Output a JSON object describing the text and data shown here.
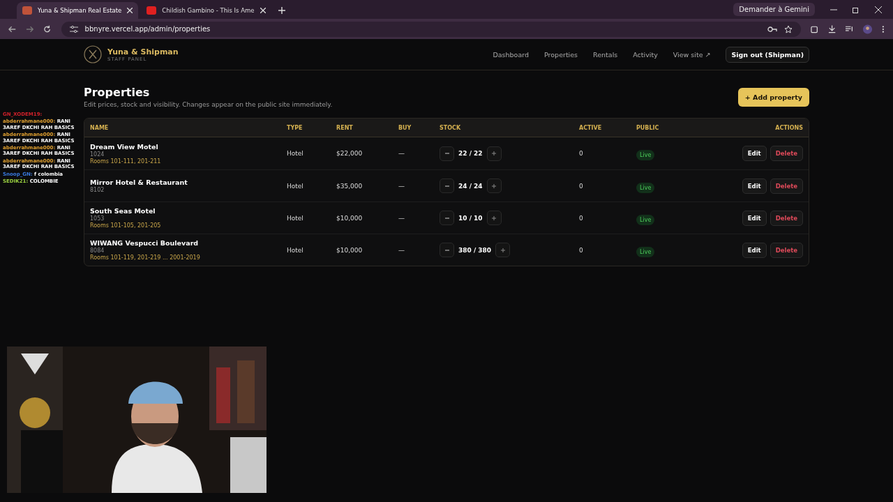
{
  "browser": {
    "tabs": [
      {
        "title": "Yuna & Shipman Real Estate",
        "selected": true
      },
      {
        "title": "Childish Gambino - This Is Ame",
        "selected": false
      }
    ],
    "gemini_button": "Demander à Gemini",
    "url": "bbnyre.vercel.app/admin/properties"
  },
  "header": {
    "brand": "Yuna & Shipman",
    "subtitle": "STAFF PANEL",
    "nav": [
      "Dashboard",
      "Properties",
      "Rentals",
      "Activity",
      "View site ↗"
    ],
    "sign_out": "Sign out (Shipman)"
  },
  "page": {
    "title": "Properties",
    "description": "Edit prices, stock and visibility. Changes appear on the public site immediately.",
    "add_button": "+ Add property"
  },
  "table": {
    "columns": [
      "NAME",
      "TYPE",
      "RENT",
      "BUY",
      "STOCK",
      "ACTIVE",
      "PUBLIC",
      "ACTIONS"
    ],
    "rows": [
      {
        "name": "Dream View Motel",
        "code": "1024",
        "rooms": "Rooms 101-111, 201-211",
        "type": "Hotel",
        "rent": "$22,000",
        "buy": "—",
        "stock": "22 / 22",
        "active": "0",
        "public": "Live",
        "edit": "Edit",
        "delete": "Delete"
      },
      {
        "name": "Mirror Hotel & Restaurant",
        "code": "8102",
        "type": "Hotel",
        "rent": "$35,000",
        "buy": "—",
        "stock": "24 / 24",
        "active": "0",
        "public": "Live",
        "edit": "Edit",
        "delete": "Delete"
      },
      {
        "name": "South Seas Motel",
        "code": "1053",
        "rooms": "Rooms 101-105, 201-205",
        "type": "Hotel",
        "rent": "$10,000",
        "buy": "—",
        "stock": "10 / 10",
        "active": "0",
        "public": "Live",
        "edit": "Edit",
        "delete": "Delete"
      },
      {
        "name": "WIWANG Vespucci Boulevard",
        "code": "8084",
        "rooms": "Rooms 101-119, 201-219 ... 2001-2019",
        "type": "Hotel",
        "rent": "$10,000",
        "buy": "—",
        "stock": "380 / 380",
        "active": "0",
        "public": "Live",
        "edit": "Edit",
        "delete": "Delete"
      }
    ]
  },
  "stream_chat": [
    {
      "user": "GN_XODEM19:",
      "color": "#d0202a"
    },
    {
      "user": "abderrahmane000:",
      "message": "RANI 3AREF DKCHI RAH BASICS",
      "color": "#e0a030"
    },
    {
      "user": "abderrahmane000:",
      "message": "RANI 3AREF DKCHI RAH BASICS",
      "color": "#e0a030"
    },
    {
      "user": "abderrahmane000:",
      "message": "RANI 3AREF DKCHI RAH BASICS",
      "color": "#e0a030"
    },
    {
      "user": "abderrahmane000:",
      "message": "RANI 3AREF DKCHI RAH BASICS",
      "color": "#e0a030"
    },
    {
      "user": "Snoop_GN:",
      "message": "f colombia",
      "color": "#3a7ae0"
    },
    {
      "user": "SEDIK21:",
      "message": "COLOMBIE",
      "color": "#9ad040"
    }
  ]
}
